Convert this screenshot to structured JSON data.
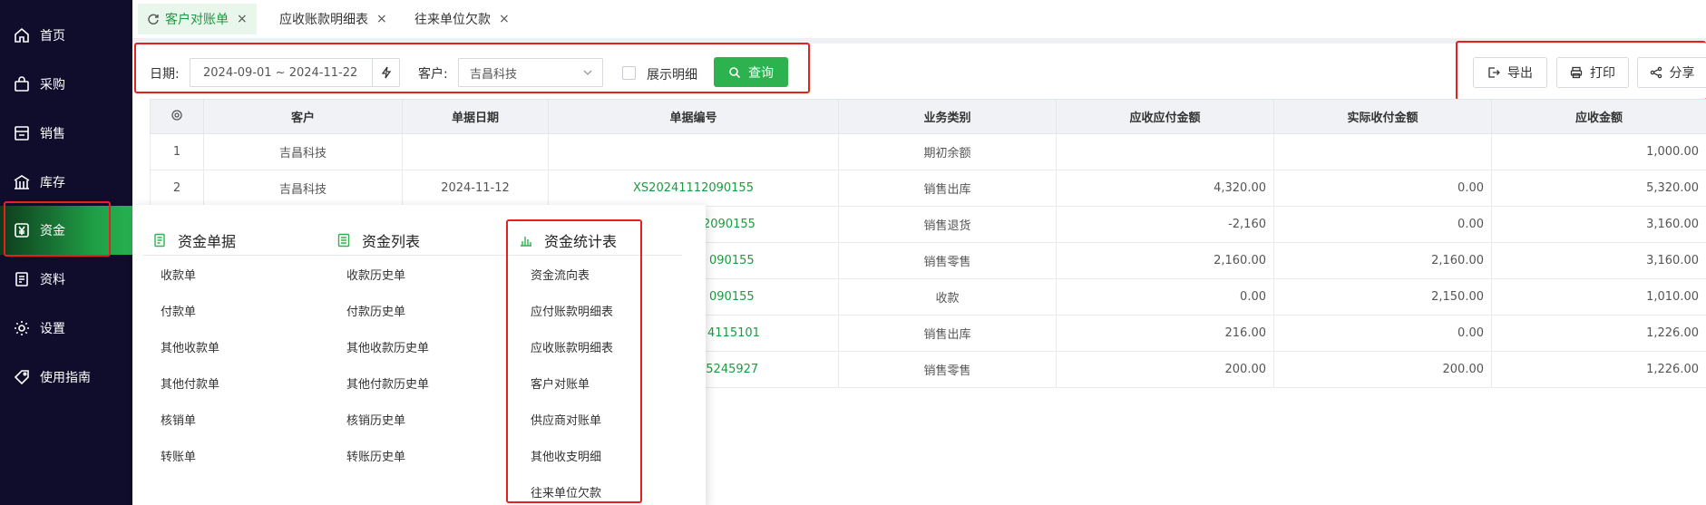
{
  "sidebar": {
    "items": [
      {
        "label": "首页",
        "icon": "home-icon"
      },
      {
        "label": "采购",
        "icon": "shopping-bag-icon"
      },
      {
        "label": "销售",
        "icon": "store-icon"
      },
      {
        "label": "库存",
        "icon": "warehouse-icon"
      },
      {
        "label": "资金",
        "icon": "yuan-icon"
      },
      {
        "label": "资料",
        "icon": "document-icon"
      },
      {
        "label": "设置",
        "icon": "gear-icon"
      },
      {
        "label": "使用指南",
        "icon": "tag-icon"
      }
    ],
    "active_index": 4,
    "active_color": "#27b34f"
  },
  "tabs": [
    {
      "label": "客户对账单",
      "active": true
    },
    {
      "label": "应收账款明细表",
      "active": false
    },
    {
      "label": "往来单位欠款",
      "active": false
    }
  ],
  "filters": {
    "date_label": "日期:",
    "date_value": "2024-09-01 ~ 2024-11-22",
    "customer_label": "客户:",
    "customer_value": "吉昌科技",
    "show_detail_label": "展示明细",
    "query_label": "查询"
  },
  "actions": {
    "export_label": "导出",
    "print_label": "打印",
    "share_label": "分享"
  },
  "table": {
    "columns": [
      "客户",
      "单据日期",
      "单据编号",
      "业务类别",
      "应收应付金额",
      "实际收付金额",
      "应收金额"
    ],
    "rows": [
      {
        "no": "1",
        "customer": "吉昌科技",
        "date": "",
        "code": "",
        "type": "期初余额",
        "due": "",
        "actual": "",
        "receivable": "1,000.00"
      },
      {
        "no": "2",
        "customer": "吉昌科技",
        "date": "2024-11-12",
        "code": "XS20241112090155",
        "type": "销售出库",
        "due": "4,320.00",
        "actual": "0.00",
        "receivable": "5,320.00"
      },
      {
        "no": "",
        "customer": "",
        "date": "",
        "code": "2090155",
        "type": "销售退货",
        "due": "-2,160",
        "actual": "0.00",
        "receivable": "3,160.00"
      },
      {
        "no": "",
        "customer": "",
        "date": "",
        "code": "090155",
        "type": "销售零售",
        "due": "2,160.00",
        "actual": "2,160.00",
        "receivable": "3,160.00"
      },
      {
        "no": "",
        "customer": "",
        "date": "",
        "code": "090155",
        "type": "收款",
        "due": "0.00",
        "actual": "2,150.00",
        "receivable": "1,010.00"
      },
      {
        "no": "",
        "customer": "",
        "date": "",
        "code": "4115101",
        "type": "销售出库",
        "due": "216.00",
        "actual": "0.00",
        "receivable": "1,226.00"
      },
      {
        "no": "",
        "customer": "",
        "date": "",
        "code": "85245927",
        "type": "销售零售",
        "due": "200.00",
        "actual": "200.00",
        "receivable": "1,226.00"
      }
    ]
  },
  "menu": {
    "columns": [
      {
        "title": "资金单据",
        "icon": "receipt-icon",
        "items": [
          "收款单",
          "付款单",
          "其他收款单",
          "其他付款单",
          "核销单",
          "转账单"
        ]
      },
      {
        "title": "资金列表",
        "icon": "list-icon",
        "items": [
          "收款历史单",
          "付款历史单",
          "其他收款历史单",
          "其他付款历史单",
          "核销历史单",
          "转账历史单"
        ]
      },
      {
        "title": "资金统计表",
        "icon": "bar-chart-icon",
        "items": [
          "资金流向表",
          "应付账款明细表",
          "应收账款明细表",
          "客户对账单",
          "供应商对账单",
          "其他收支明细",
          "往来单位欠款"
        ]
      }
    ]
  },
  "colors": {
    "sidebar_bg": "#0f0c2c",
    "accent_green": "#2eb24f",
    "link_green": "#1a9c3e",
    "highlight_red": "#e3221f"
  }
}
